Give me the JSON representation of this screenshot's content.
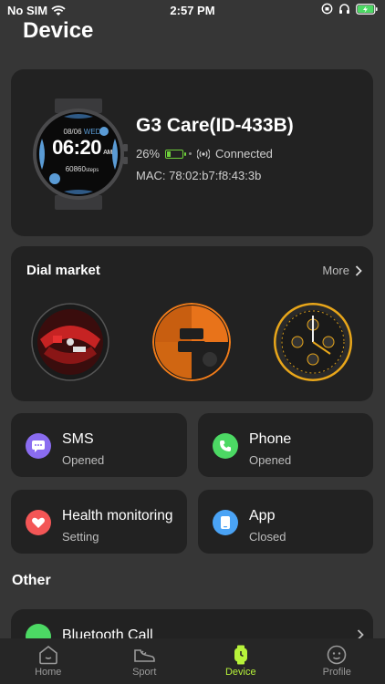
{
  "status": {
    "carrier": "No SIM",
    "time": "2:57 PM"
  },
  "page_title": "Device",
  "device": {
    "name": "G3 Care(ID-433B)",
    "battery_percent": "26%",
    "battery_level": 0.26,
    "connection": "Connected",
    "mac": "MAC: 78:02:b7:f8:43:3b",
    "watch_date": "08/06",
    "watch_day": "WED",
    "watch_time": "06:20",
    "watch_ampm": "AM",
    "watch_steps": "60860",
    "watch_steps_unit": "steps"
  },
  "dial_market": {
    "title": "Dial market",
    "more_label": "More"
  },
  "tiles": [
    {
      "title": "SMS",
      "subtitle": "Opened",
      "color": "#8a6cf0",
      "icon": "message-icon"
    },
    {
      "title": "Phone",
      "subtitle": "Opened",
      "color": "#4cd964",
      "icon": "phone-icon"
    },
    {
      "title": "Health monitoring",
      "subtitle": "Setting",
      "color": "#f35656",
      "icon": "heart-icon"
    },
    {
      "title": "App",
      "subtitle": "Closed",
      "color": "#4aa3f5",
      "icon": "app-icon"
    }
  ],
  "other": {
    "title": "Other",
    "bluetooth_call": "Bluetooth Call"
  },
  "tabs": [
    {
      "label": "Home",
      "icon": "home-icon",
      "active": false
    },
    {
      "label": "Sport",
      "icon": "sport-shoe-icon",
      "active": false
    },
    {
      "label": "Device",
      "icon": "watch-icon",
      "active": true
    },
    {
      "label": "Profile",
      "icon": "profile-icon",
      "active": false
    }
  ],
  "colors": {
    "accent": "#b7f33a",
    "background": "#363636",
    "card": "#222222",
    "battery": "#6fd13b"
  }
}
